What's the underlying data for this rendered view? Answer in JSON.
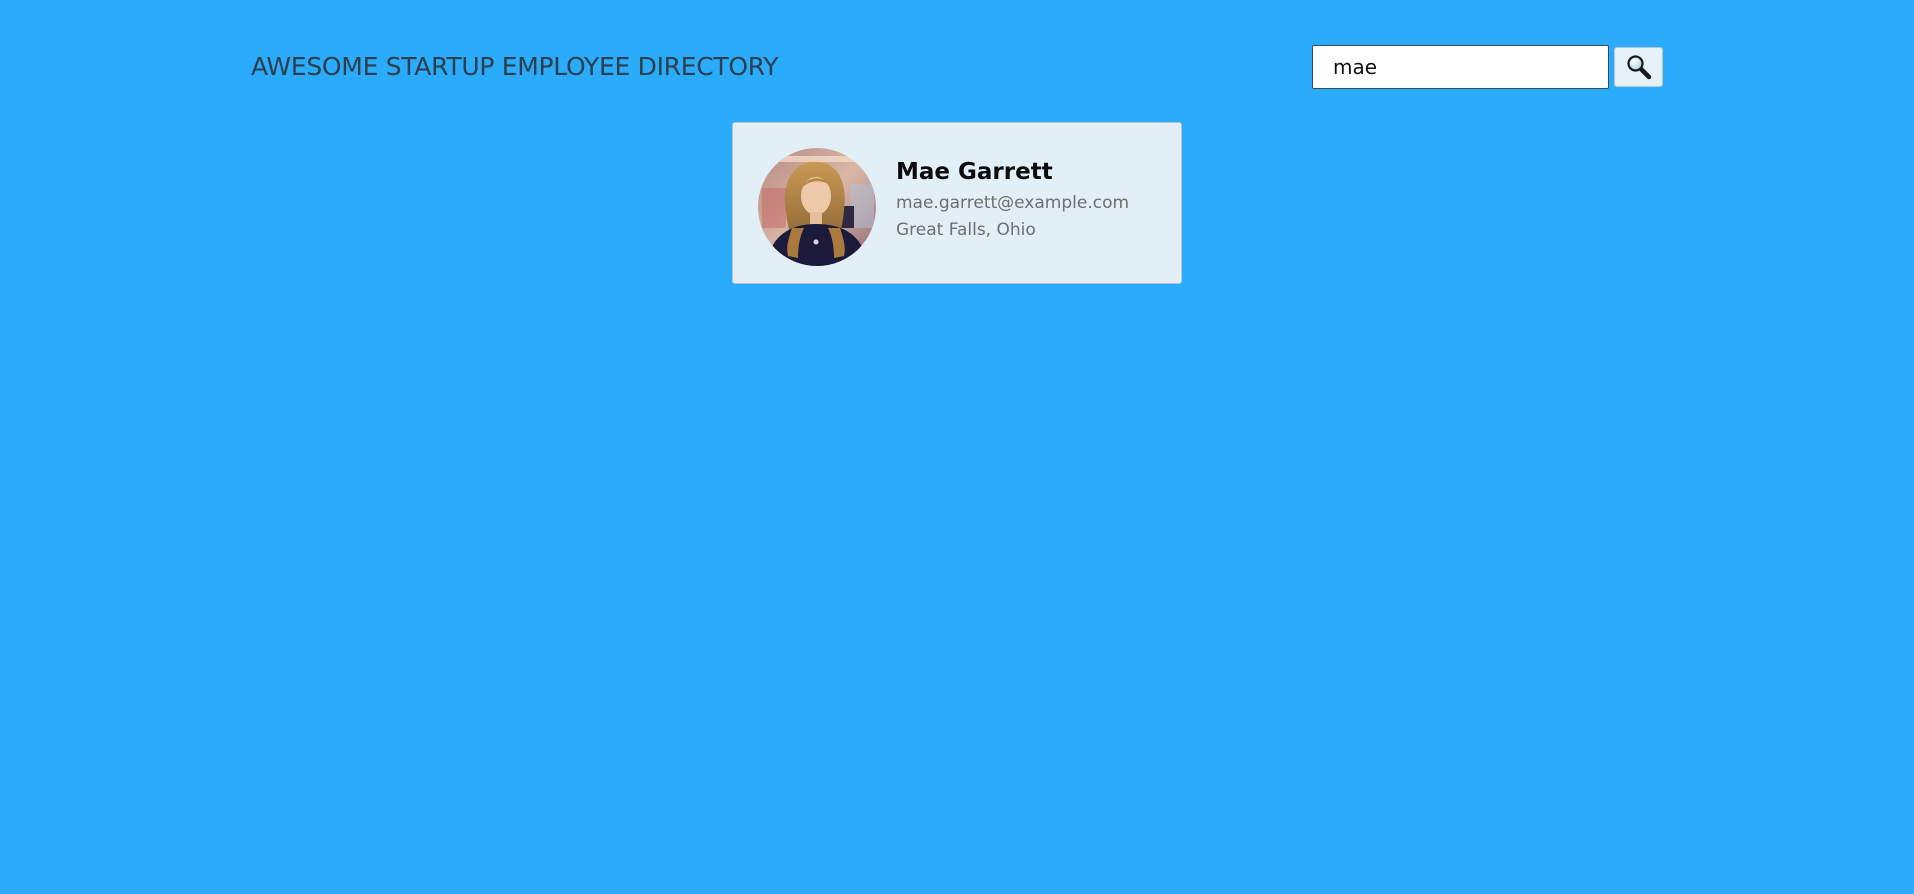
{
  "header": {
    "title": "AWESOME STARTUP EMPLOYEE DIRECTORY"
  },
  "search": {
    "value": "mae",
    "button_icon": "magnifying-glass-icon"
  },
  "employees": [
    {
      "name": "Mae Garrett",
      "email": "mae.garrett@example.com",
      "location": "Great Falls, Ohio",
      "avatar_icon": "employee-photo"
    }
  ],
  "colors": {
    "background": "#2aabfc",
    "card": "#e3eff7",
    "title": "#2d3e4c"
  }
}
